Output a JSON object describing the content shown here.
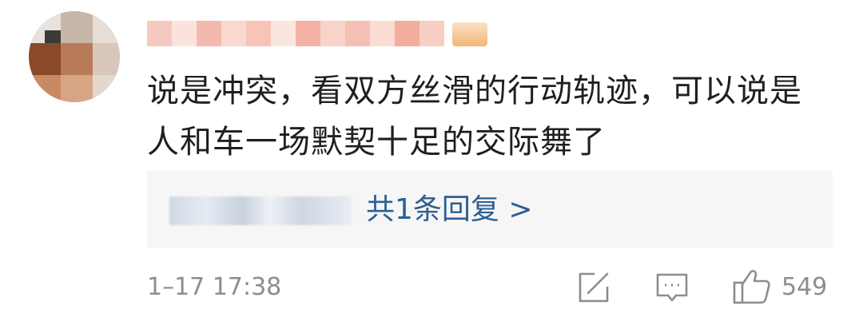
{
  "comment": {
    "text": "说是冲突，看双方丝滑的行动轨迹，可以说是人和车一场默契十足的交际舞了",
    "reply_summary": "共1条回复 >",
    "timestamp": "1–17 17:38",
    "like_count": "549"
  },
  "icons": {
    "share": "share-icon",
    "comment": "comment-icon",
    "like": "thumbs-up-icon",
    "badge": "vip-badge-icon"
  },
  "colors": {
    "text": "#1f1f1f",
    "link": "#2e5f93",
    "meta": "#8d8d8d",
    "reply_bg": "#f6f6f6"
  }
}
